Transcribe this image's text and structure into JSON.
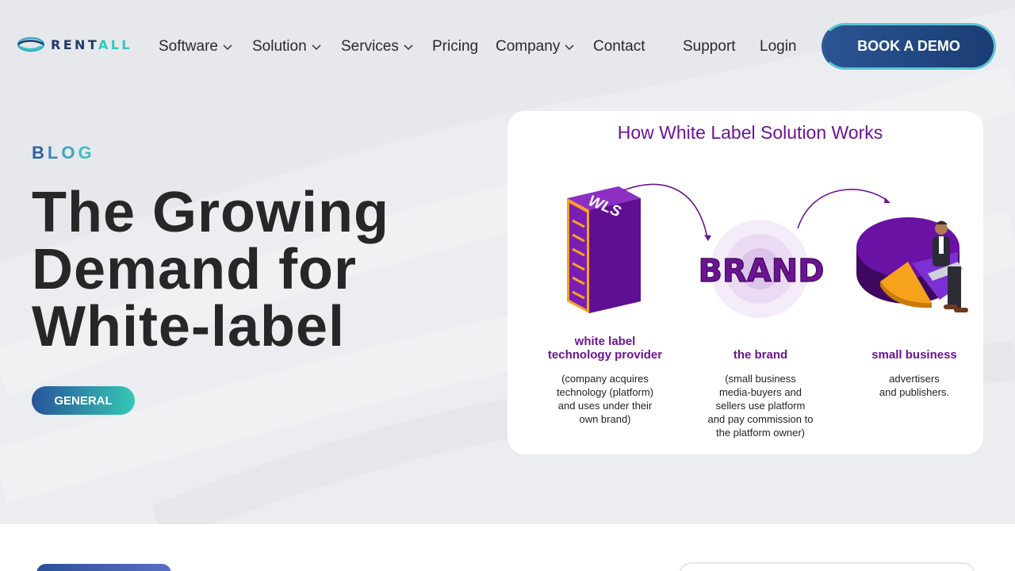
{
  "brand": {
    "logo_part1": "RENT",
    "logo_part2": "ALL",
    "logo_icon": "eye-wave-icon"
  },
  "nav": {
    "items": [
      {
        "label": "Software",
        "has_dropdown": true
      },
      {
        "label": "Solution",
        "has_dropdown": true
      },
      {
        "label": "Services",
        "has_dropdown": true
      },
      {
        "label": "Pricing",
        "has_dropdown": false
      },
      {
        "label": "Company",
        "has_dropdown": true
      },
      {
        "label": "Contact",
        "has_dropdown": false
      }
    ],
    "support": "Support",
    "login": "Login",
    "cta": "BOOK A DEMO"
  },
  "hero": {
    "eyebrow": [
      "B",
      "L",
      "O",
      "G"
    ],
    "title_lines": [
      "The Growing",
      "Demand for",
      "White-label"
    ],
    "tag": "GENERAL"
  },
  "infographic": {
    "title": "How White Label Solution Works",
    "server_label": "WLS",
    "brand_word": "BRAND",
    "columns": [
      {
        "heading": [
          "white label",
          "technology provider"
        ],
        "desc": [
          "(company acquires",
          "technology (platform)",
          "and uses under their",
          "own brand)"
        ]
      },
      {
        "heading": [
          "the brand"
        ],
        "desc": [
          "(small business",
          "media-buyers and",
          "sellers use platform",
          "and pay commission to",
          "the platform owner)"
        ]
      },
      {
        "heading": [
          "small business"
        ],
        "desc": [
          "advertisers",
          "and publishers."
        ]
      }
    ]
  },
  "colors": {
    "accent_navy": "#1f3a6b",
    "accent_teal": "#35c6bb",
    "purple": "#6c1493"
  }
}
